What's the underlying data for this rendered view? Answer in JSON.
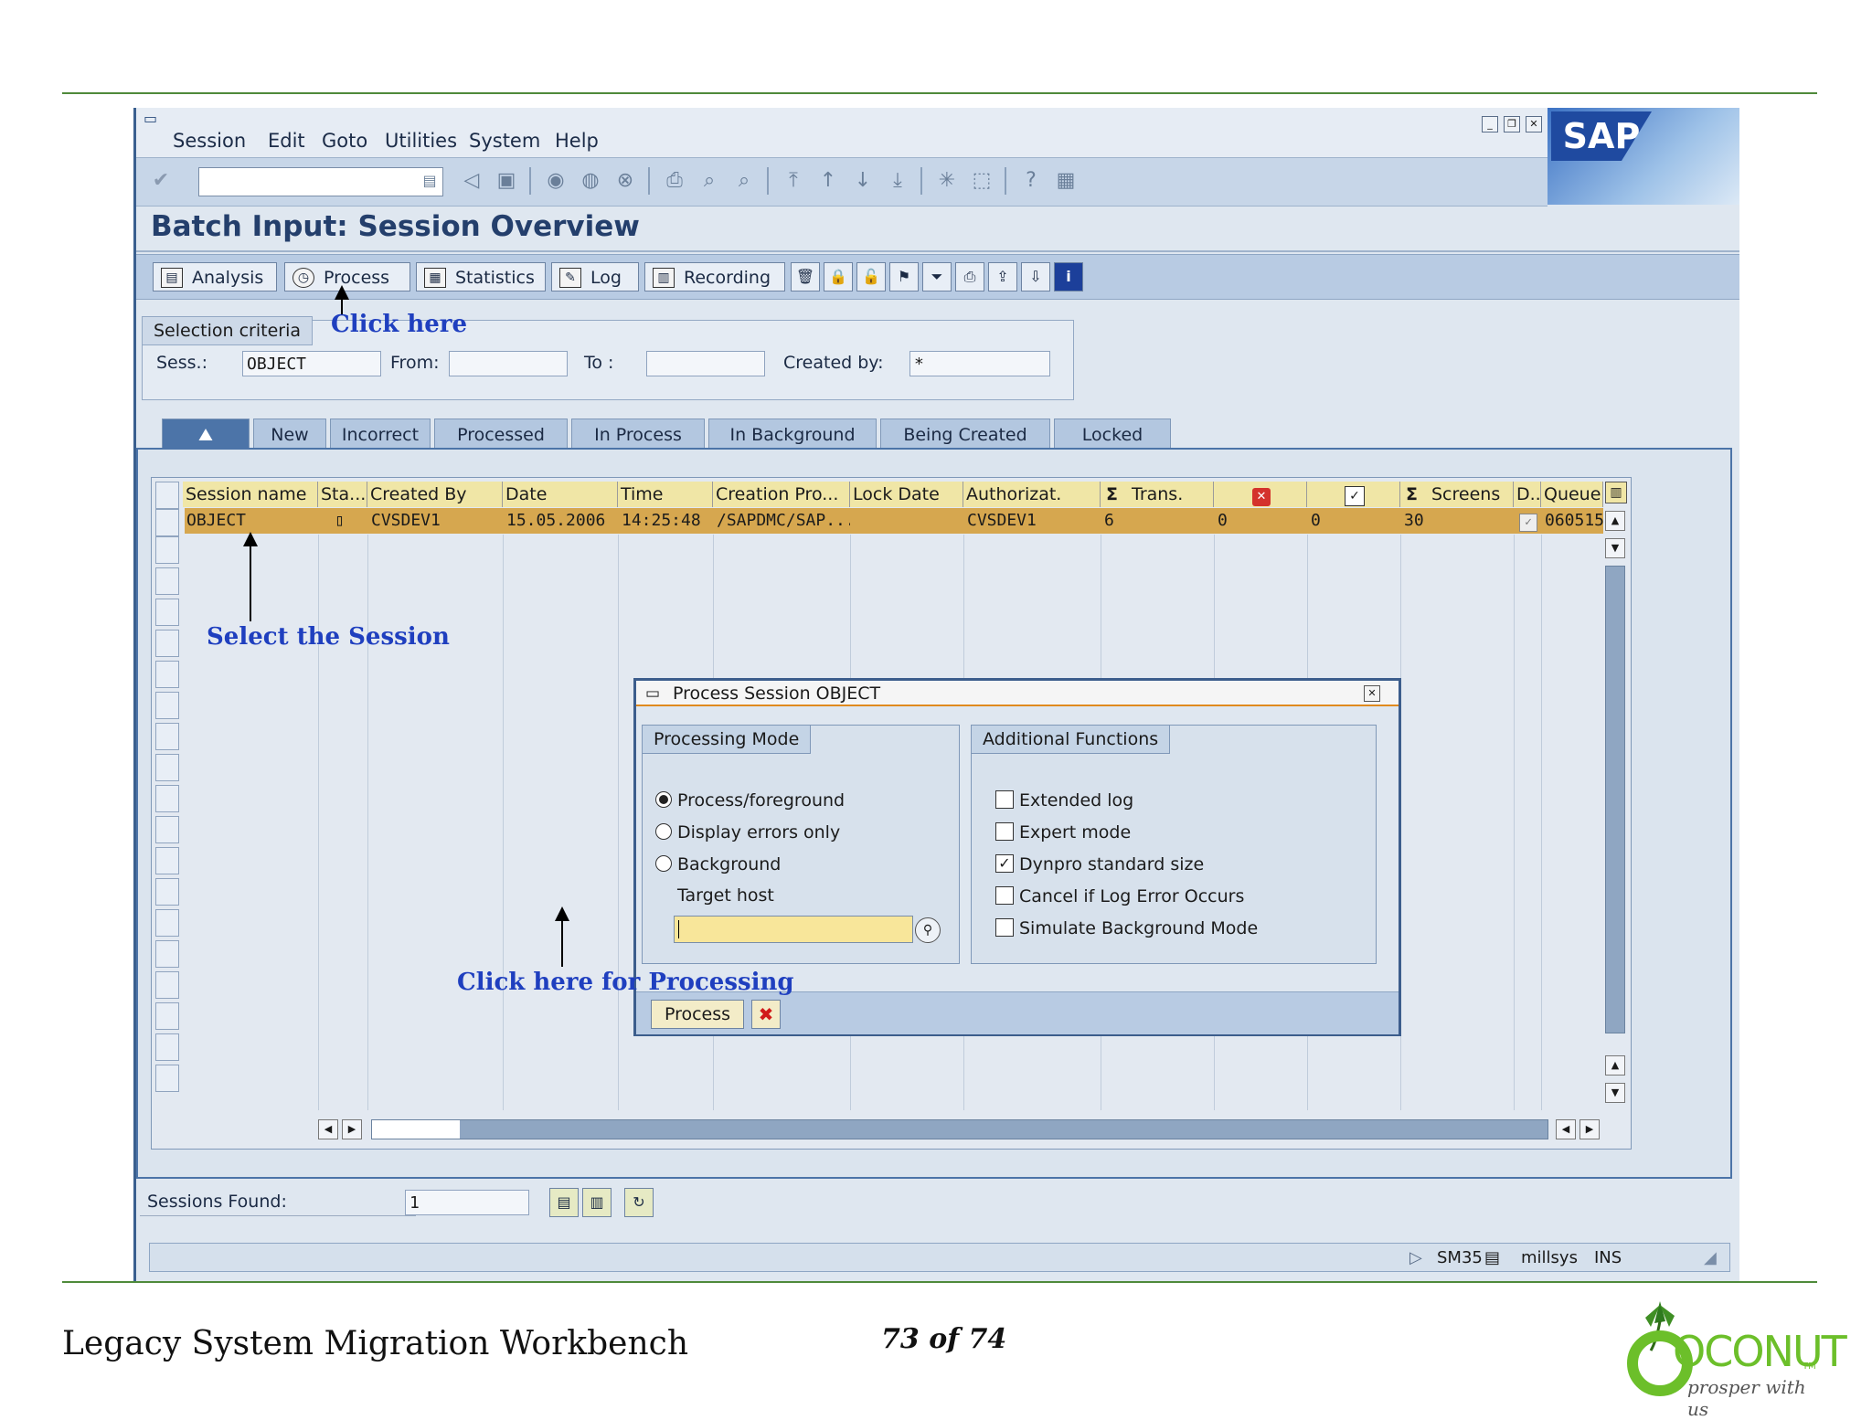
{
  "menu": [
    "Session",
    "Edit",
    "Goto",
    "Utilities",
    "System",
    "Help"
  ],
  "sap_logo": "SAP",
  "title": "Batch Input: Session Overview",
  "app_toolbar": {
    "analysis": "Analysis",
    "process": "Process",
    "statistics": "Statistics",
    "log": "Log",
    "recording": "Recording"
  },
  "selection": {
    "header": "Selection criteria",
    "sess_label": "Sess.:",
    "sess_value": "OBJECT",
    "from_label": "From:",
    "to_label": "To :",
    "created_by_label": "Created by:",
    "created_by_value": "*"
  },
  "tabs": [
    "New",
    "Incorrect",
    "Processed",
    "In Process",
    "In Background",
    "Being Created",
    "Locked"
  ],
  "table": {
    "headers": [
      "Session name",
      "Sta...",
      "Created By",
      "Date",
      "Time",
      "Creation Pro...",
      "Lock Date",
      "Authorizat.",
      "Trans.",
      "",
      "",
      "Screens",
      "D..",
      "Queue"
    ],
    "row": {
      "session": "OBJECT",
      "created_by": "CVSDEV1",
      "date": "15.05.2006",
      "time": "14:25:48",
      "program": "/SAPDMC/SAP...",
      "lock_date": "",
      "authorization": "CVSDEV1",
      "trans": "6",
      "errors": "0",
      "processed": "0",
      "screens": "30",
      "queue": "060515"
    }
  },
  "dialog": {
    "title": "Process Session OBJECT",
    "mode_header": "Processing Mode",
    "modes": [
      "Process/foreground",
      "Display errors only",
      "Background"
    ],
    "selected_mode": "Process/foreground",
    "target_host_label": "Target host",
    "target_host_value": "",
    "func_header": "Additional Functions",
    "functions": [
      "Extended log",
      "Expert mode",
      "Dynpro standard size",
      "Cancel if Log Error Occurs",
      "Simulate Background Mode"
    ],
    "checked_function": "Dynpro standard size",
    "process_button": "Process"
  },
  "sessions_found_label": "Sessions Found:",
  "sessions_found_value": "1",
  "status": {
    "tcode": "SM35",
    "server": "millsys",
    "mode": "INS"
  },
  "annotations": {
    "click_here": "Click here",
    "select_session": "Select the Session",
    "click_processing": "Click here for Processing"
  },
  "footer": {
    "left": "Legacy System Migration Workbench",
    "page": "73 of 74",
    "logo_word": "OCONUT",
    "logo_tm": "TM",
    "logo_tagline": "prosper with us"
  },
  "colors": {
    "selected_row": "#d6a74f",
    "header_cell": "#f0e6a6",
    "annotation": "#1f3fbf",
    "title": "#243f6c"
  }
}
